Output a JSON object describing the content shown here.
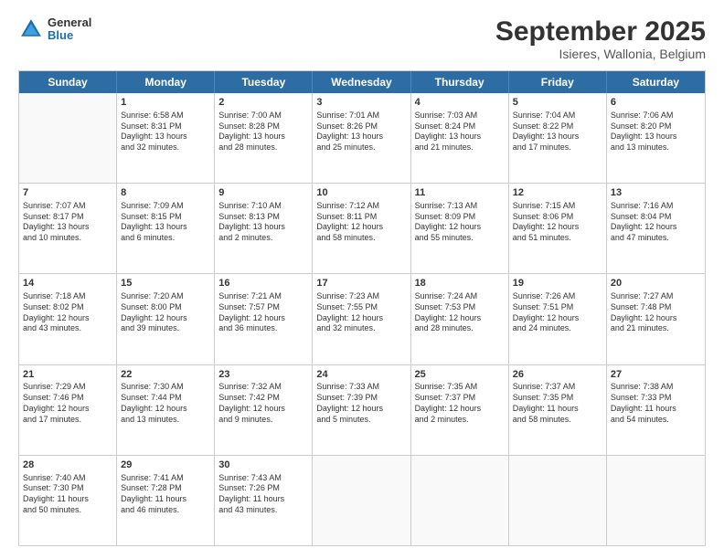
{
  "header": {
    "logo": {
      "general": "General",
      "blue": "Blue"
    },
    "title": "September 2025",
    "subtitle": "Isieres, Wallonia, Belgium"
  },
  "days": [
    "Sunday",
    "Monday",
    "Tuesday",
    "Wednesday",
    "Thursday",
    "Friday",
    "Saturday"
  ],
  "weeks": [
    [
      {
        "day": "",
        "lines": []
      },
      {
        "day": "1",
        "lines": [
          "Sunrise: 6:58 AM",
          "Sunset: 8:31 PM",
          "Daylight: 13 hours",
          "and 32 minutes."
        ]
      },
      {
        "day": "2",
        "lines": [
          "Sunrise: 7:00 AM",
          "Sunset: 8:28 PM",
          "Daylight: 13 hours",
          "and 28 minutes."
        ]
      },
      {
        "day": "3",
        "lines": [
          "Sunrise: 7:01 AM",
          "Sunset: 8:26 PM",
          "Daylight: 13 hours",
          "and 25 minutes."
        ]
      },
      {
        "day": "4",
        "lines": [
          "Sunrise: 7:03 AM",
          "Sunset: 8:24 PM",
          "Daylight: 13 hours",
          "and 21 minutes."
        ]
      },
      {
        "day": "5",
        "lines": [
          "Sunrise: 7:04 AM",
          "Sunset: 8:22 PM",
          "Daylight: 13 hours",
          "and 17 minutes."
        ]
      },
      {
        "day": "6",
        "lines": [
          "Sunrise: 7:06 AM",
          "Sunset: 8:20 PM",
          "Daylight: 13 hours",
          "and 13 minutes."
        ]
      }
    ],
    [
      {
        "day": "7",
        "lines": [
          "Sunrise: 7:07 AM",
          "Sunset: 8:17 PM",
          "Daylight: 13 hours",
          "and 10 minutes."
        ]
      },
      {
        "day": "8",
        "lines": [
          "Sunrise: 7:09 AM",
          "Sunset: 8:15 PM",
          "Daylight: 13 hours",
          "and 6 minutes."
        ]
      },
      {
        "day": "9",
        "lines": [
          "Sunrise: 7:10 AM",
          "Sunset: 8:13 PM",
          "Daylight: 13 hours",
          "and 2 minutes."
        ]
      },
      {
        "day": "10",
        "lines": [
          "Sunrise: 7:12 AM",
          "Sunset: 8:11 PM",
          "Daylight: 12 hours",
          "and 58 minutes."
        ]
      },
      {
        "day": "11",
        "lines": [
          "Sunrise: 7:13 AM",
          "Sunset: 8:09 PM",
          "Daylight: 12 hours",
          "and 55 minutes."
        ]
      },
      {
        "day": "12",
        "lines": [
          "Sunrise: 7:15 AM",
          "Sunset: 8:06 PM",
          "Daylight: 12 hours",
          "and 51 minutes."
        ]
      },
      {
        "day": "13",
        "lines": [
          "Sunrise: 7:16 AM",
          "Sunset: 8:04 PM",
          "Daylight: 12 hours",
          "and 47 minutes."
        ]
      }
    ],
    [
      {
        "day": "14",
        "lines": [
          "Sunrise: 7:18 AM",
          "Sunset: 8:02 PM",
          "Daylight: 12 hours",
          "and 43 minutes."
        ]
      },
      {
        "day": "15",
        "lines": [
          "Sunrise: 7:20 AM",
          "Sunset: 8:00 PM",
          "Daylight: 12 hours",
          "and 39 minutes."
        ]
      },
      {
        "day": "16",
        "lines": [
          "Sunrise: 7:21 AM",
          "Sunset: 7:57 PM",
          "Daylight: 12 hours",
          "and 36 minutes."
        ]
      },
      {
        "day": "17",
        "lines": [
          "Sunrise: 7:23 AM",
          "Sunset: 7:55 PM",
          "Daylight: 12 hours",
          "and 32 minutes."
        ]
      },
      {
        "day": "18",
        "lines": [
          "Sunrise: 7:24 AM",
          "Sunset: 7:53 PM",
          "Daylight: 12 hours",
          "and 28 minutes."
        ]
      },
      {
        "day": "19",
        "lines": [
          "Sunrise: 7:26 AM",
          "Sunset: 7:51 PM",
          "Daylight: 12 hours",
          "and 24 minutes."
        ]
      },
      {
        "day": "20",
        "lines": [
          "Sunrise: 7:27 AM",
          "Sunset: 7:48 PM",
          "Daylight: 12 hours",
          "and 21 minutes."
        ]
      }
    ],
    [
      {
        "day": "21",
        "lines": [
          "Sunrise: 7:29 AM",
          "Sunset: 7:46 PM",
          "Daylight: 12 hours",
          "and 17 minutes."
        ]
      },
      {
        "day": "22",
        "lines": [
          "Sunrise: 7:30 AM",
          "Sunset: 7:44 PM",
          "Daylight: 12 hours",
          "and 13 minutes."
        ]
      },
      {
        "day": "23",
        "lines": [
          "Sunrise: 7:32 AM",
          "Sunset: 7:42 PM",
          "Daylight: 12 hours",
          "and 9 minutes."
        ]
      },
      {
        "day": "24",
        "lines": [
          "Sunrise: 7:33 AM",
          "Sunset: 7:39 PM",
          "Daylight: 12 hours",
          "and 5 minutes."
        ]
      },
      {
        "day": "25",
        "lines": [
          "Sunrise: 7:35 AM",
          "Sunset: 7:37 PM",
          "Daylight: 12 hours",
          "and 2 minutes."
        ]
      },
      {
        "day": "26",
        "lines": [
          "Sunrise: 7:37 AM",
          "Sunset: 7:35 PM",
          "Daylight: 11 hours",
          "and 58 minutes."
        ]
      },
      {
        "day": "27",
        "lines": [
          "Sunrise: 7:38 AM",
          "Sunset: 7:33 PM",
          "Daylight: 11 hours",
          "and 54 minutes."
        ]
      }
    ],
    [
      {
        "day": "28",
        "lines": [
          "Sunrise: 7:40 AM",
          "Sunset: 7:30 PM",
          "Daylight: 11 hours",
          "and 50 minutes."
        ]
      },
      {
        "day": "29",
        "lines": [
          "Sunrise: 7:41 AM",
          "Sunset: 7:28 PM",
          "Daylight: 11 hours",
          "and 46 minutes."
        ]
      },
      {
        "day": "30",
        "lines": [
          "Sunrise: 7:43 AM",
          "Sunset: 7:26 PM",
          "Daylight: 11 hours",
          "and 43 minutes."
        ]
      },
      {
        "day": "",
        "lines": []
      },
      {
        "day": "",
        "lines": []
      },
      {
        "day": "",
        "lines": []
      },
      {
        "day": "",
        "lines": []
      }
    ]
  ]
}
